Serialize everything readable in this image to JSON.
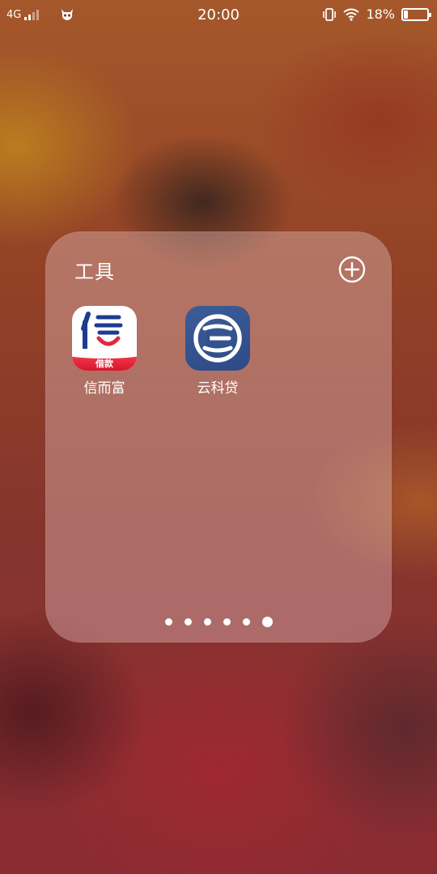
{
  "status_bar": {
    "network": "4G",
    "time": "20:00",
    "battery_percent": "18%",
    "battery_level": 0.18,
    "icons": [
      "signal-icon",
      "notification-app-icon",
      "vibrate-icon",
      "wifi-icon",
      "battery-icon"
    ]
  },
  "folder": {
    "title": "工具",
    "add_icon": "plus-circle-icon",
    "apps": [
      {
        "name": "信而富",
        "icon": "xinerfu-app-icon",
        "icon_char": "信",
        "badge": "借款"
      },
      {
        "name": "云科贷",
        "icon": "yunkedai-app-icon"
      }
    ],
    "pages": {
      "count": 6,
      "active": 6
    }
  },
  "colors": {
    "folder_bg": "#ebc8c8",
    "xin_red": "#e02a3c",
    "xin_blue": "#1d3c8f",
    "yun_blue": "#34508c"
  }
}
